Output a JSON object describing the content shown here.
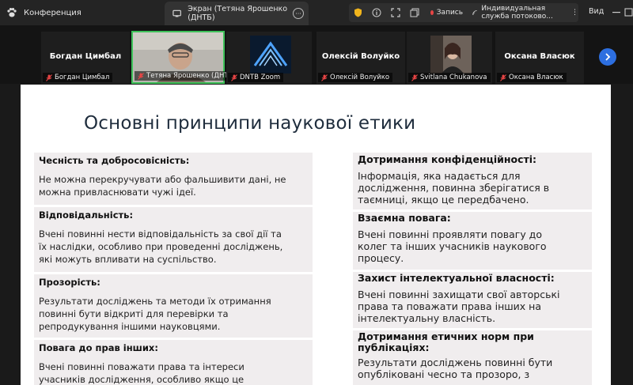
{
  "app": {
    "name": "Конференция"
  },
  "screen_tab": {
    "title": "Экран (Тетяна Ярошенко (ДНТБ)",
    "more": "···"
  },
  "toolbar": {
    "record_label": "Запись",
    "stream_label": "Индивидуальная служба потоково...",
    "view_label": "Вид"
  },
  "gallery": {
    "tiles": [
      {
        "name": "Богдан Цимбал",
        "label": "Богдан Цимбал"
      },
      {
        "name": "",
        "label": "Тетяна Ярошенко (ДНТБ)"
      },
      {
        "name": "",
        "label": "DNTB Zoom"
      },
      {
        "name": "Олексій Волуйко",
        "label": "Олексій Волуйко"
      },
      {
        "name": "",
        "label": "Svitlana Chukanova"
      },
      {
        "name": "Оксана Власюк",
        "label": "Оксана Власюк"
      }
    ]
  },
  "slide": {
    "title": "Основні принципи наукової етики",
    "left": [
      {
        "heading": "Чесність та добросовісність:",
        "body": [
          "Не можна перекручувати або фальшивити дані, не",
          "можна привласнювати чужі ідеї."
        ]
      },
      {
        "heading": "Відповідальність:",
        "body": [
          "Вчені повинні нести відповідальність за свої дії та",
          "їх наслідки, особливо при проведенні досліджень,",
          "які можуть впливати на суспільство."
        ]
      },
      {
        "heading": "Прозорість:",
        "body": [
          "Результати досліджень та методи їх отримання",
          "повинні бути відкриті для перевірки та",
          "репродукування іншими науковцями."
        ]
      },
      {
        "heading": "Повага до прав інших:",
        "body": [
          "Вчені повинні поважати права та інтереси",
          "учасників дослідження, особливо якщо це"
        ]
      }
    ],
    "right": [
      {
        "heading": "Дотримання конфіденційності:",
        "body": [
          "Інформація, яка надається для",
          "дослідження, повинна зберігатися в",
          "таємниці, якщо це передбачено."
        ]
      },
      {
        "heading": "Взаємна повага:",
        "body": [
          "Вчені повинні проявляти повагу до",
          "колег та інших учасників наукового",
          "процесу."
        ]
      },
      {
        "heading": "Захист інтелектуальної власності:",
        "body": [
          "Вчені повинні захищати свої авторські",
          "права та поважати права інших на",
          "інтелектуальну власність."
        ]
      },
      {
        "heading": "Дотримання етичних норм при публікаціях:",
        "body": [
          "Результати досліджень повинні бути",
          "опубліковані чесно та прозоро, з"
        ]
      }
    ]
  }
}
